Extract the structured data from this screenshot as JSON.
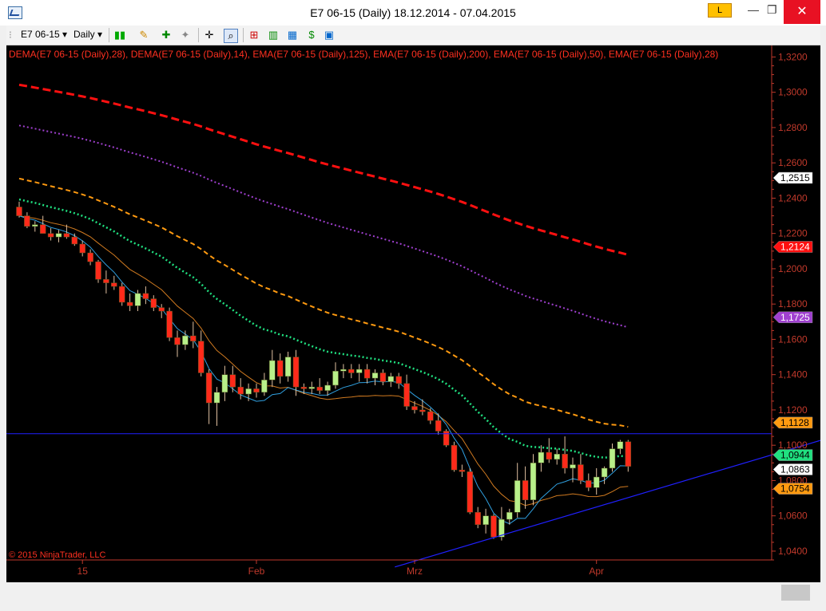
{
  "window": {
    "title": "E7 06-15 (Daily)  18.12.2014 - 07.04.2015",
    "badge": "L",
    "minimize": "—",
    "restore": "❐",
    "close": "✕"
  },
  "toolbar": {
    "instrument": "E7 06-15",
    "period": "Daily"
  },
  "indicators_label": "DEMA(E7 06-15 (Daily),28), DEMA(E7 06-15 (Daily),14), EMA(E7 06-15 (Daily),125), EMA(E7 06-15 (Daily),200), EMA(E7 06-15 (Daily),50), EMA(E7 06-15 (Daily),28)",
  "copyright": "© 2015 NinjaTrader, LLC",
  "colors": {
    "background": "#000000",
    "up_candle": "#b8f08a",
    "down_candle": "#ff2a1a",
    "ema200": "#ff1010",
    "ema125": "#a040d0",
    "ema50": "#ff9a10",
    "ema28": "#20e080",
    "dema14": "#30a0e0",
    "dema28": "#d07a20",
    "trendline": "#2020ff"
  },
  "chart_data": {
    "type": "candlestick",
    "y_axis": {
      "min": 1.035,
      "max": 1.322,
      "ticks": [
        "1,3200",
        "1,3000",
        "1,2800",
        "1,2600",
        "1,2400",
        "1,2200",
        "1,2000",
        "1,1800",
        "1,1600",
        "1,1400",
        "1,1200",
        "1,1000",
        "1,0800",
        "1,0600",
        "1,0400"
      ]
    },
    "x_axis": {
      "labels": [
        {
          "text": "15",
          "index": 8
        },
        {
          "text": "Feb",
          "index": 30
        },
        {
          "text": "Mrz",
          "index": 50
        },
        {
          "text": "Apr",
          "index": 73
        }
      ]
    },
    "candles": [
      [
        1.235,
        1.238,
        1.229,
        1.23
      ],
      [
        1.23,
        1.232,
        1.223,
        1.224
      ],
      [
        1.224,
        1.227,
        1.221,
        1.225
      ],
      [
        1.225,
        1.23,
        1.22,
        1.22
      ],
      [
        1.22,
        1.223,
        1.216,
        1.218
      ],
      [
        1.218,
        1.222,
        1.215,
        1.22
      ],
      [
        1.22,
        1.225,
        1.217,
        1.218
      ],
      [
        1.218,
        1.22,
        1.213,
        1.214
      ],
      [
        1.214,
        1.216,
        1.207,
        1.209
      ],
      [
        1.209,
        1.211,
        1.202,
        1.204
      ],
      [
        1.204,
        1.205,
        1.192,
        1.194
      ],
      [
        1.194,
        1.199,
        1.186,
        1.192
      ],
      [
        1.192,
        1.196,
        1.188,
        1.19
      ],
      [
        1.19,
        1.192,
        1.179,
        1.181
      ],
      [
        1.181,
        1.186,
        1.176,
        1.179
      ],
      [
        1.179,
        1.188,
        1.176,
        1.186
      ],
      [
        1.186,
        1.19,
        1.18,
        1.183
      ],
      [
        1.183,
        1.185,
        1.176,
        1.178
      ],
      [
        1.178,
        1.18,
        1.172,
        1.176
      ],
      [
        1.176,
        1.178,
        1.159,
        1.161
      ],
      [
        1.161,
        1.165,
        1.15,
        1.157
      ],
      [
        1.157,
        1.165,
        1.154,
        1.162
      ],
      [
        1.162,
        1.17,
        1.155,
        1.159
      ],
      [
        1.159,
        1.165,
        1.139,
        1.141
      ],
      [
        1.141,
        1.143,
        1.112,
        1.124
      ],
      [
        1.124,
        1.133,
        1.111,
        1.13
      ],
      [
        1.13,
        1.145,
        1.125,
        1.14
      ],
      [
        1.14,
        1.145,
        1.13,
        1.133
      ],
      [
        1.133,
        1.138,
        1.126,
        1.129
      ],
      [
        1.129,
        1.135,
        1.125,
        1.132
      ],
      [
        1.132,
        1.135,
        1.127,
        1.13
      ],
      [
        1.13,
        1.141,
        1.128,
        1.137
      ],
      [
        1.137,
        1.154,
        1.133,
        1.148
      ],
      [
        1.148,
        1.152,
        1.135,
        1.139
      ],
      [
        1.139,
        1.153,
        1.136,
        1.15
      ],
      [
        1.15,
        1.154,
        1.128,
        1.133
      ],
      [
        1.133,
        1.135,
        1.129,
        1.132
      ],
      [
        1.132,
        1.136,
        1.129,
        1.133
      ],
      [
        1.133,
        1.138,
        1.129,
        1.131
      ],
      [
        1.131,
        1.136,
        1.128,
        1.134
      ],
      [
        1.134,
        1.147,
        1.132,
        1.142
      ],
      [
        1.142,
        1.146,
        1.138,
        1.143
      ],
      [
        1.143,
        1.146,
        1.138,
        1.141
      ],
      [
        1.141,
        1.146,
        1.136,
        1.143
      ],
      [
        1.143,
        1.146,
        1.135,
        1.138
      ],
      [
        1.138,
        1.143,
        1.134,
        1.141
      ],
      [
        1.141,
        1.143,
        1.134,
        1.136
      ],
      [
        1.136,
        1.141,
        1.133,
        1.139
      ],
      [
        1.139,
        1.141,
        1.132,
        1.135
      ],
      [
        1.135,
        1.14,
        1.12,
        1.122
      ],
      [
        1.122,
        1.125,
        1.118,
        1.12
      ],
      [
        1.12,
        1.126,
        1.117,
        1.119
      ],
      [
        1.119,
        1.121,
        1.112,
        1.114
      ],
      [
        1.114,
        1.118,
        1.106,
        1.108
      ],
      [
        1.108,
        1.109,
        1.099,
        1.1
      ],
      [
        1.1,
        1.102,
        1.085,
        1.086
      ],
      [
        1.086,
        1.089,
        1.082,
        1.085
      ],
      [
        1.085,
        1.087,
        1.061,
        1.062
      ],
      [
        1.062,
        1.065,
        1.053,
        1.055
      ],
      [
        1.055,
        1.064,
        1.05,
        1.06
      ],
      [
        1.06,
        1.061,
        1.047,
        1.048
      ],
      [
        1.048,
        1.065,
        1.046,
        1.058
      ],
      [
        1.058,
        1.064,
        1.055,
        1.062
      ],
      [
        1.062,
        1.09,
        1.059,
        1.08
      ],
      [
        1.08,
        1.088,
        1.064,
        1.069
      ],
      [
        1.069,
        1.095,
        1.066,
        1.09
      ],
      [
        1.09,
        1.1,
        1.085,
        1.096
      ],
      [
        1.096,
        1.104,
        1.09,
        1.092
      ],
      [
        1.092,
        1.098,
        1.089,
        1.095
      ],
      [
        1.095,
        1.105,
        1.084,
        1.087
      ],
      [
        1.087,
        1.093,
        1.079,
        1.089
      ],
      [
        1.089,
        1.095,
        1.078,
        1.08
      ],
      [
        1.08,
        1.084,
        1.074,
        1.076
      ],
      [
        1.076,
        1.087,
        1.072,
        1.082
      ],
      [
        1.082,
        1.088,
        1.078,
        1.087
      ],
      [
        1.087,
        1.101,
        1.085,
        1.098
      ],
      [
        1.098,
        1.103,
        1.095,
        1.102
      ],
      [
        1.102,
        1.103,
        1.085,
        1.088
      ]
    ],
    "price_labels": [
      {
        "text": "1,2515",
        "value": 1.2515,
        "color": "#ffffff",
        "textColor": "#000000"
      },
      {
        "text": "1,2124",
        "value": 1.2124,
        "color": "#ff1010",
        "textColor": "#ffffff"
      },
      {
        "text": "1,1725",
        "value": 1.1725,
        "color": "#a040d0",
        "textColor": "#ffffff"
      },
      {
        "text": "1,1128",
        "value": 1.1128,
        "color": "#ff9a10",
        "textColor": "#000000"
      },
      {
        "text": "1,0944",
        "value": 1.0944,
        "color": "#20e080",
        "textColor": "#000000"
      },
      {
        "text": "1,0863",
        "value": 1.0863,
        "color": "#ffffff",
        "textColor": "#000000"
      },
      {
        "text": "1,0754",
        "value": 1.0754,
        "color": "#ff9a10",
        "textColor": "#000000"
      }
    ],
    "horizontal_line": 1.1065,
    "trendline": {
      "from": [
        47.5,
        1.031
      ],
      "to": [
        112,
        1.117
      ]
    }
  }
}
